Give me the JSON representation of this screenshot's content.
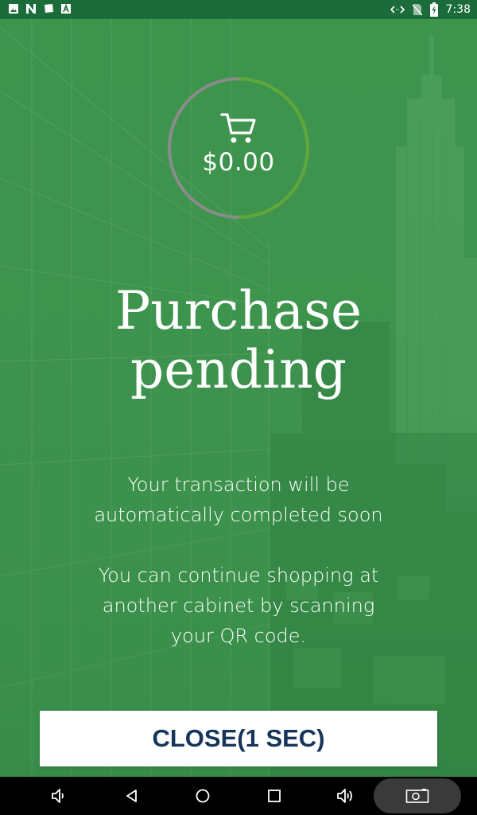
{
  "status_bar": {
    "time": "7:38",
    "left_icons": [
      "image-icon",
      "n-app-icon",
      "message-icon",
      "a-app-icon"
    ],
    "right_icons": [
      "sync-arrows-icon",
      "no-sim-icon",
      "battery-charging-icon"
    ]
  },
  "summary": {
    "cart_total": "$0.00",
    "progress_fraction": 0.5,
    "progress_color": "#5fa83a",
    "track_color": "#8b8b8b"
  },
  "title": "Purchase\npending",
  "messages": {
    "line1": "Your transaction will be\nautomatically completed soon",
    "line2": "You can continue shopping at\nanother cabinet by scanning\nyour QR code."
  },
  "close_button": {
    "label": "CLOSE(1 SEC)"
  },
  "nav_bar": {
    "buttons": [
      "volume-down-icon",
      "back-icon",
      "home-icon",
      "recents-icon",
      "volume-up-icon",
      "camera-icon"
    ]
  },
  "colors": {
    "background": "#3d944d",
    "status_bar": "#1c6b3a",
    "button_text": "#15355a"
  }
}
